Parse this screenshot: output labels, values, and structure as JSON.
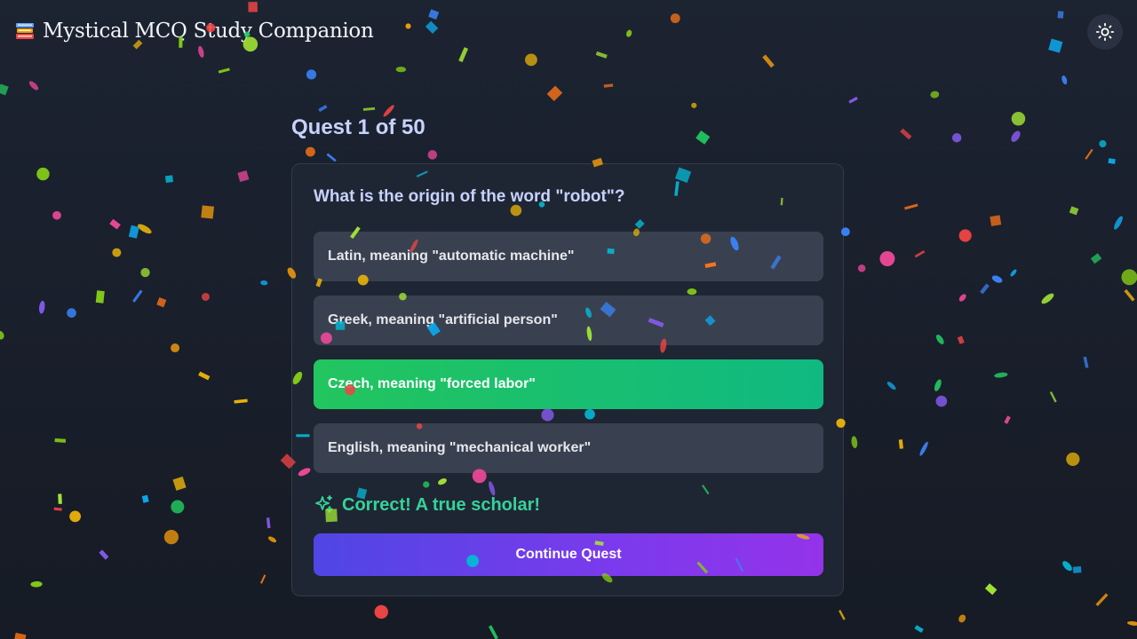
{
  "header": {
    "title": "Mystical MCQ Study Companion",
    "logo_icon": "books-icon"
  },
  "theme_toggle": {
    "icon": "sun-icon"
  },
  "quest": {
    "title": "Quest 1 of 50",
    "current": 1,
    "total": 50
  },
  "question": {
    "text": "What is the origin of the word \"robot\"?",
    "options": [
      {
        "label": "Latin, meaning \"automatic machine\"",
        "state": "default"
      },
      {
        "label": "Greek, meaning \"artificial person\"",
        "state": "default"
      },
      {
        "label": "Czech, meaning \"forced labor\"",
        "state": "correct"
      },
      {
        "label": "English, meaning \"mechanical worker\"",
        "state": "default"
      }
    ]
  },
  "feedback": {
    "icon": "sparkles-icon",
    "text": "Correct! A true scholar!",
    "color": "#34d399"
  },
  "continue_button": {
    "label": "Continue Quest"
  },
  "colors": {
    "background": "#1a202c",
    "accent": "#6d28d9",
    "correct": "#22c55e",
    "confetti": [
      "#ef4444",
      "#f59e0b",
      "#eab308",
      "#22c55e",
      "#06b6d4",
      "#3b82f6",
      "#8b5cf6",
      "#ec4899",
      "#84cc16",
      "#0ea5e9",
      "#f97316",
      "#a3e635"
    ]
  }
}
